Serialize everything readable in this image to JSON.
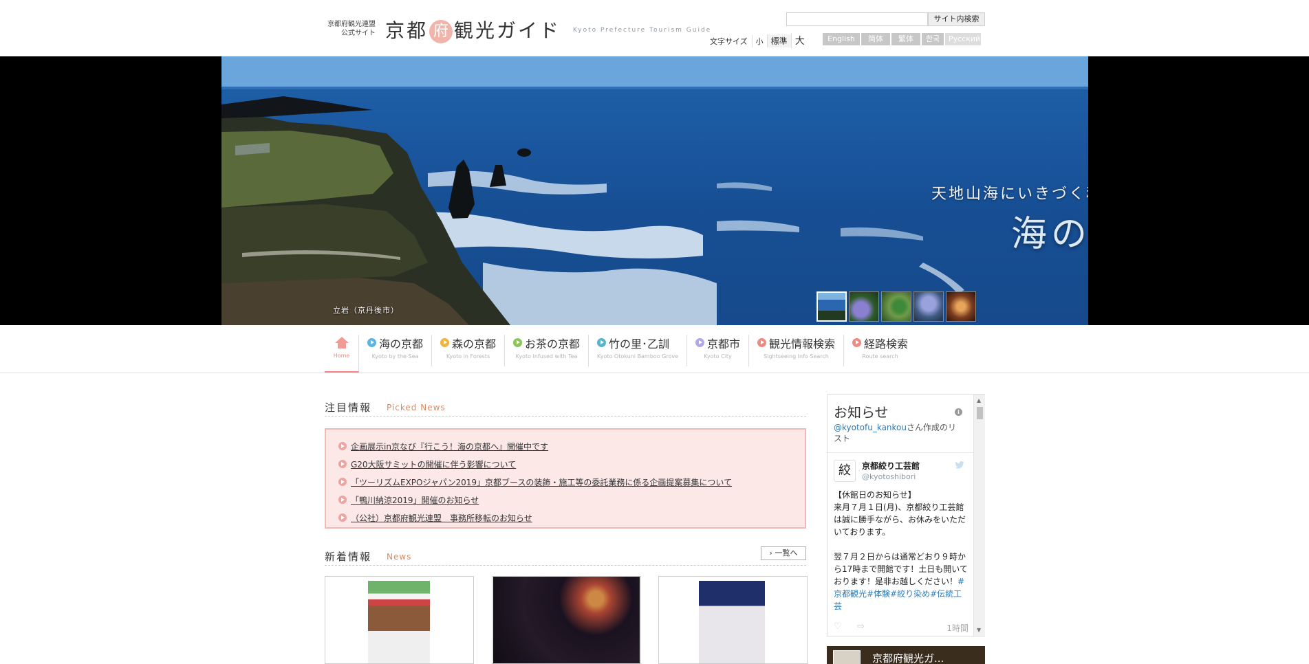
{
  "header": {
    "org_line1": "京都府観光連盟",
    "org_line2": "公式サイト",
    "title_pre": "京都",
    "title_fu": "府",
    "title_post": "観光ガイド",
    "title_en": "Kyoto Prefecture Tourism Guide",
    "search_placeholder": "",
    "search_button": "サイト内検索",
    "fontsize_label": "文字サイズ",
    "fontsize_small": "小",
    "fontsize_normal": "標準",
    "fontsize_large": "大",
    "languages": [
      "English",
      "简体字",
      "繁体字",
      "한국",
      "Русский"
    ]
  },
  "hero": {
    "tagline": "天地山海にいきづく和の源流",
    "headline": "海の京都",
    "headline_arrow": "›",
    "caption": "立岩（京丹後市）"
  },
  "nav": {
    "home_en": "Home",
    "items": [
      {
        "jp": "海の京都",
        "en": "Kyoto by the Sea",
        "color": "#5bb4e2"
      },
      {
        "jp": "森の京都",
        "en": "Kyoto in Forests",
        "color": "#f0b440"
      },
      {
        "jp": "お茶の京都",
        "en": "Kyoto Infused with Tea",
        "color": "#8dc55a"
      },
      {
        "jp": "竹の里･乙訓",
        "en": "Kyoto Otokuni Bamboo Grove",
        "color": "#5ab3c9"
      },
      {
        "jp": "京都市",
        "en": "Kyoto City",
        "color": "#b4a7e6"
      },
      {
        "jp": "観光情報検索",
        "en": "Sightseeing Info Search",
        "color": "#ef8a80"
      },
      {
        "jp": "経路検索",
        "en": "Route search",
        "color": "#ef8a80"
      }
    ]
  },
  "picked": {
    "title_jp": "注目情報",
    "title_en": "Picked News",
    "items": [
      "企画展示in京なび『行こう！海の京都へ』開催中です",
      "G20大阪サミットの開催に伴う影響について",
      "「ツーリズムEXPOジャパン2019」京都ブースの装飾・施工等の委託業務に係る企画提案募集について",
      "「鴨川納涼2019」開催のお知らせ",
      "（公社）京都府観光連盟　事務所移転のお知らせ"
    ]
  },
  "news": {
    "title_jp": "新着情報",
    "title_en": "News",
    "more": "一覧へ"
  },
  "twitter": {
    "title": "お知らせ",
    "info_icon": "i",
    "list_by_handle": "@kyotofu_kankou",
    "list_by_suffix": "さん作成のリスト",
    "tweet_name": "京都絞り工芸館",
    "tweet_handle": "@kyotoshibori",
    "avatar_text": "絞",
    "tweet_text": "【休館日のお知らせ】\n来月７月１日(月)、京都絞り工芸館は誠に勝手ながら、お休みをいただいております。\n\n翌７月２日からは通常どおり９時から17時まで開館です！土日も開いております！是非お越しください！",
    "tweet_tags": "#京都観光#体験#絞り染め#伝統工芸",
    "tweet_time": "1時間"
  },
  "fb_banner": {
    "text": "京都府観光ガ..."
  }
}
